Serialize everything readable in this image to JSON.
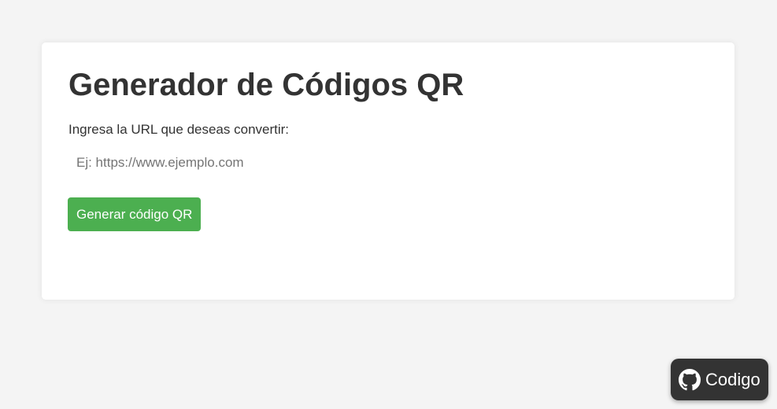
{
  "main": {
    "title": "Generador de Códigos QR",
    "url_label": "Ingresa la URL que deseas convertir:",
    "url_input": {
      "value": "",
      "placeholder": "Ej: https://www.ejemplo.com"
    },
    "generate_button_label": "Generar código QR"
  },
  "footer_link": {
    "label": "Codigo",
    "icon": "github-icon"
  },
  "colors": {
    "background": "#f4f4f4",
    "card": "#ffffff",
    "text": "#333333",
    "button_accent": "#4caf50",
    "code_button": "#333333"
  }
}
